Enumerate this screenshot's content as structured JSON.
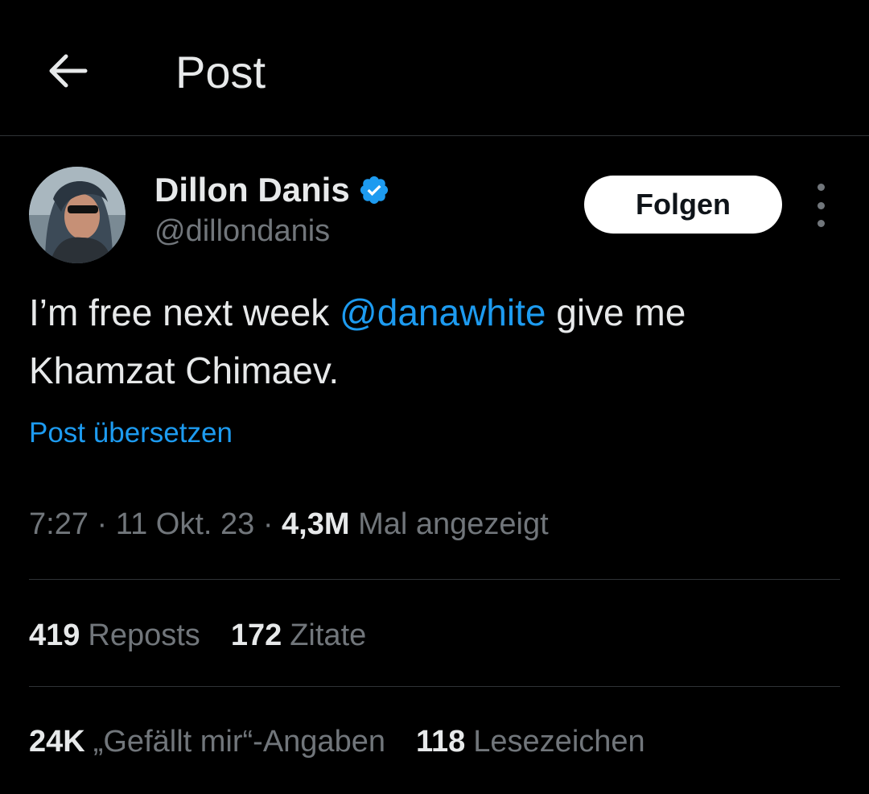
{
  "header": {
    "title": "Post"
  },
  "author": {
    "display_name": "Dillon Danis",
    "handle": "@dillondanis",
    "verified": true,
    "verified_color": "#1d9bf0"
  },
  "actions": {
    "follow_label": "Folgen"
  },
  "post": {
    "text_before": "I’m free next week ",
    "mention": "@danawhite",
    "text_after": " give me Khamzat Chimaev.",
    "translate_label": "Post übersetzen"
  },
  "meta": {
    "time": "7:27",
    "sep1": " · ",
    "date": "11 Okt. 23",
    "sep2": " · ",
    "views_count": "4,3M",
    "views_label": " Mal angezeigt"
  },
  "stats_row1": [
    {
      "count": "419",
      "label": "Reposts"
    },
    {
      "count": "172",
      "label": "Zitate"
    }
  ],
  "stats_row2": [
    {
      "count": "24K",
      "label": "„Gefällt mir“-Angaben"
    },
    {
      "count": "118",
      "label": "Lesezeichen"
    }
  ],
  "colors": {
    "accent": "#1d9bf0",
    "background": "#000000",
    "muted": "#71767b",
    "text": "#e7e9ea"
  }
}
